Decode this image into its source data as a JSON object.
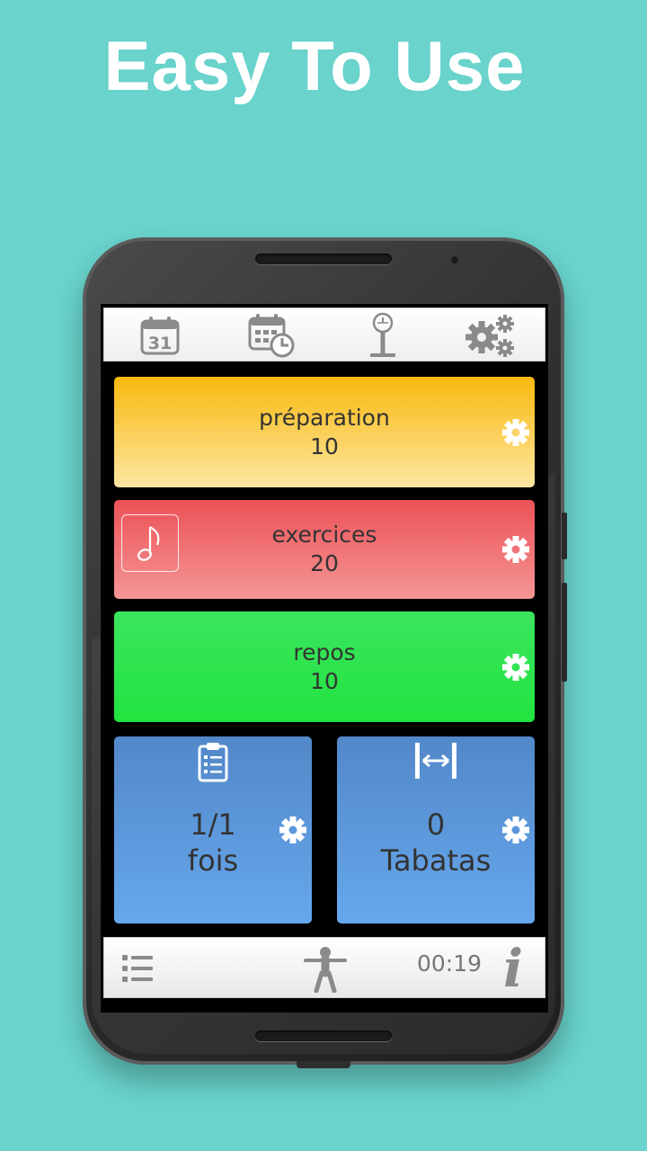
{
  "headline": "Easy To Use",
  "toolbar": {
    "items": [
      {
        "name": "calendar-icon",
        "text": "31"
      },
      {
        "name": "calendar-schedule-icon"
      },
      {
        "name": "scale-icon"
      },
      {
        "name": "settings-gears-icon"
      }
    ]
  },
  "cards": {
    "preparation": {
      "label": "préparation",
      "value": "10",
      "color": "#f9b90e"
    },
    "exercices": {
      "label": "exercices",
      "value": "20",
      "color": "#ec5257"
    },
    "repos": {
      "label": "repos",
      "value": "10",
      "color": "#3be45e"
    },
    "rounds": {
      "line1": "1/1",
      "line2": "fois",
      "color": "#5288c9"
    },
    "tabatas": {
      "line1": "0",
      "line2": "Tabatas",
      "color": "#5288c9"
    }
  },
  "bottombar": {
    "timer": "00:19",
    "info": "i"
  },
  "colors": {
    "background": "#69d3cc",
    "gear": "#ffffff",
    "toolbar_icon": "#888888"
  }
}
